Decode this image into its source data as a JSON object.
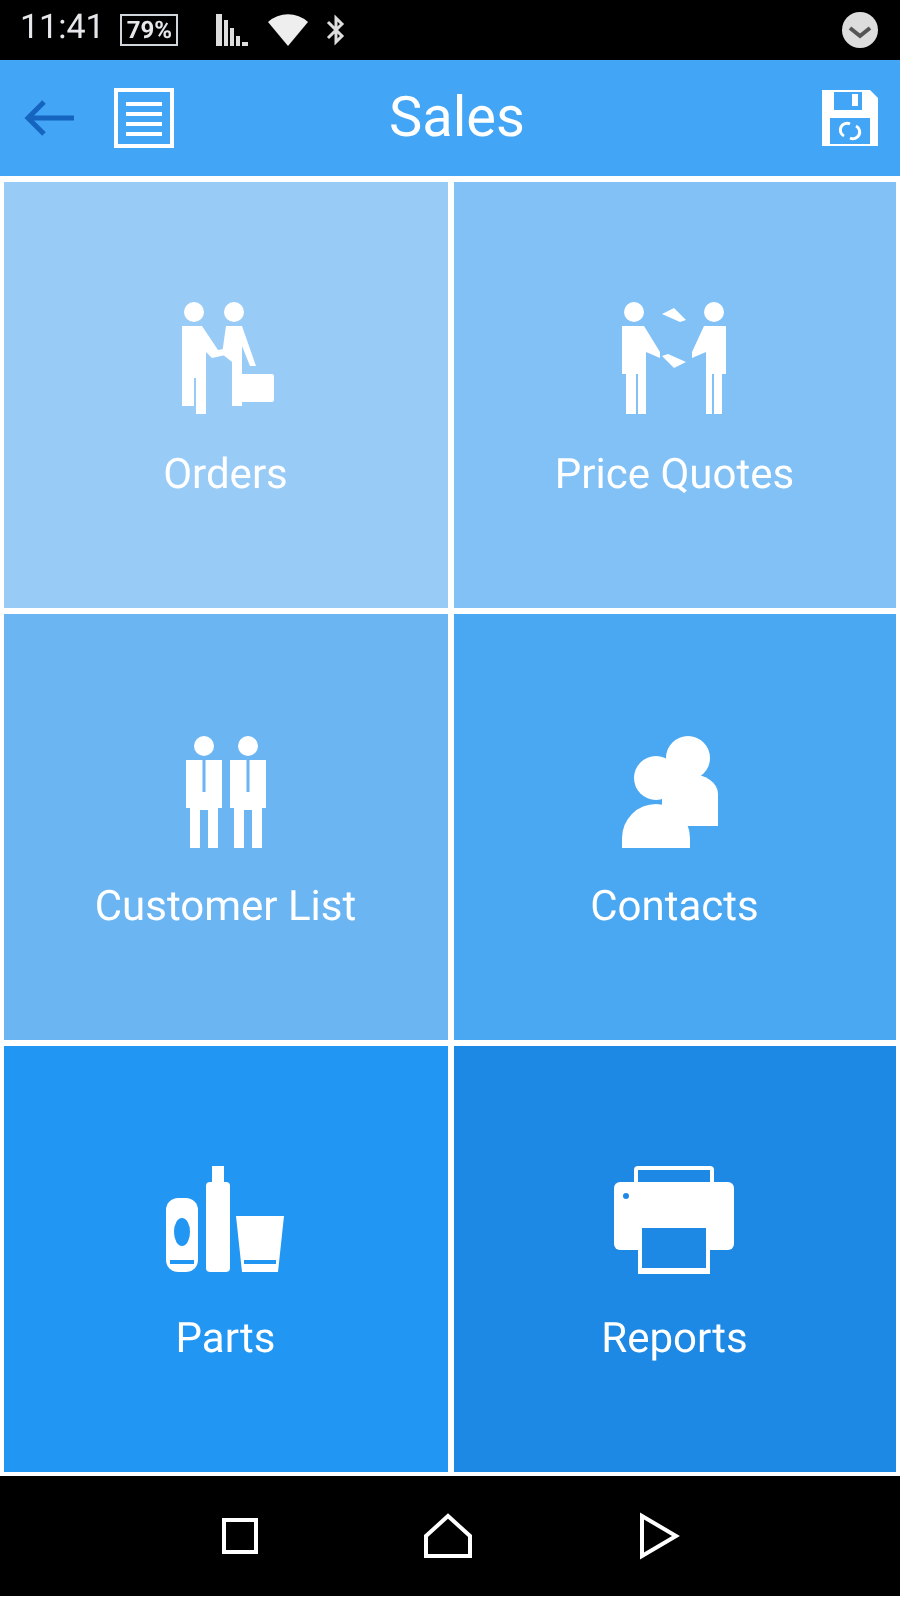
{
  "status_bar": {
    "time": "11:41",
    "battery": "79%"
  },
  "header": {
    "title": "Sales"
  },
  "tiles": [
    {
      "label": "Orders",
      "kind": "handshake",
      "color": "#99cbf7"
    },
    {
      "label": "Price Quotes",
      "kind": "exchange",
      "color": "#82c1f6"
    },
    {
      "label": "Customer List",
      "kind": "people",
      "color": "#6bb5f3"
    },
    {
      "label": "Contacts",
      "kind": "contacts",
      "color": "#4aa7f1"
    },
    {
      "label": "Parts",
      "kind": "bottles",
      "color": "#2196f3"
    },
    {
      "label": "Reports",
      "kind": "printer",
      "color": "#1e88e5"
    }
  ]
}
